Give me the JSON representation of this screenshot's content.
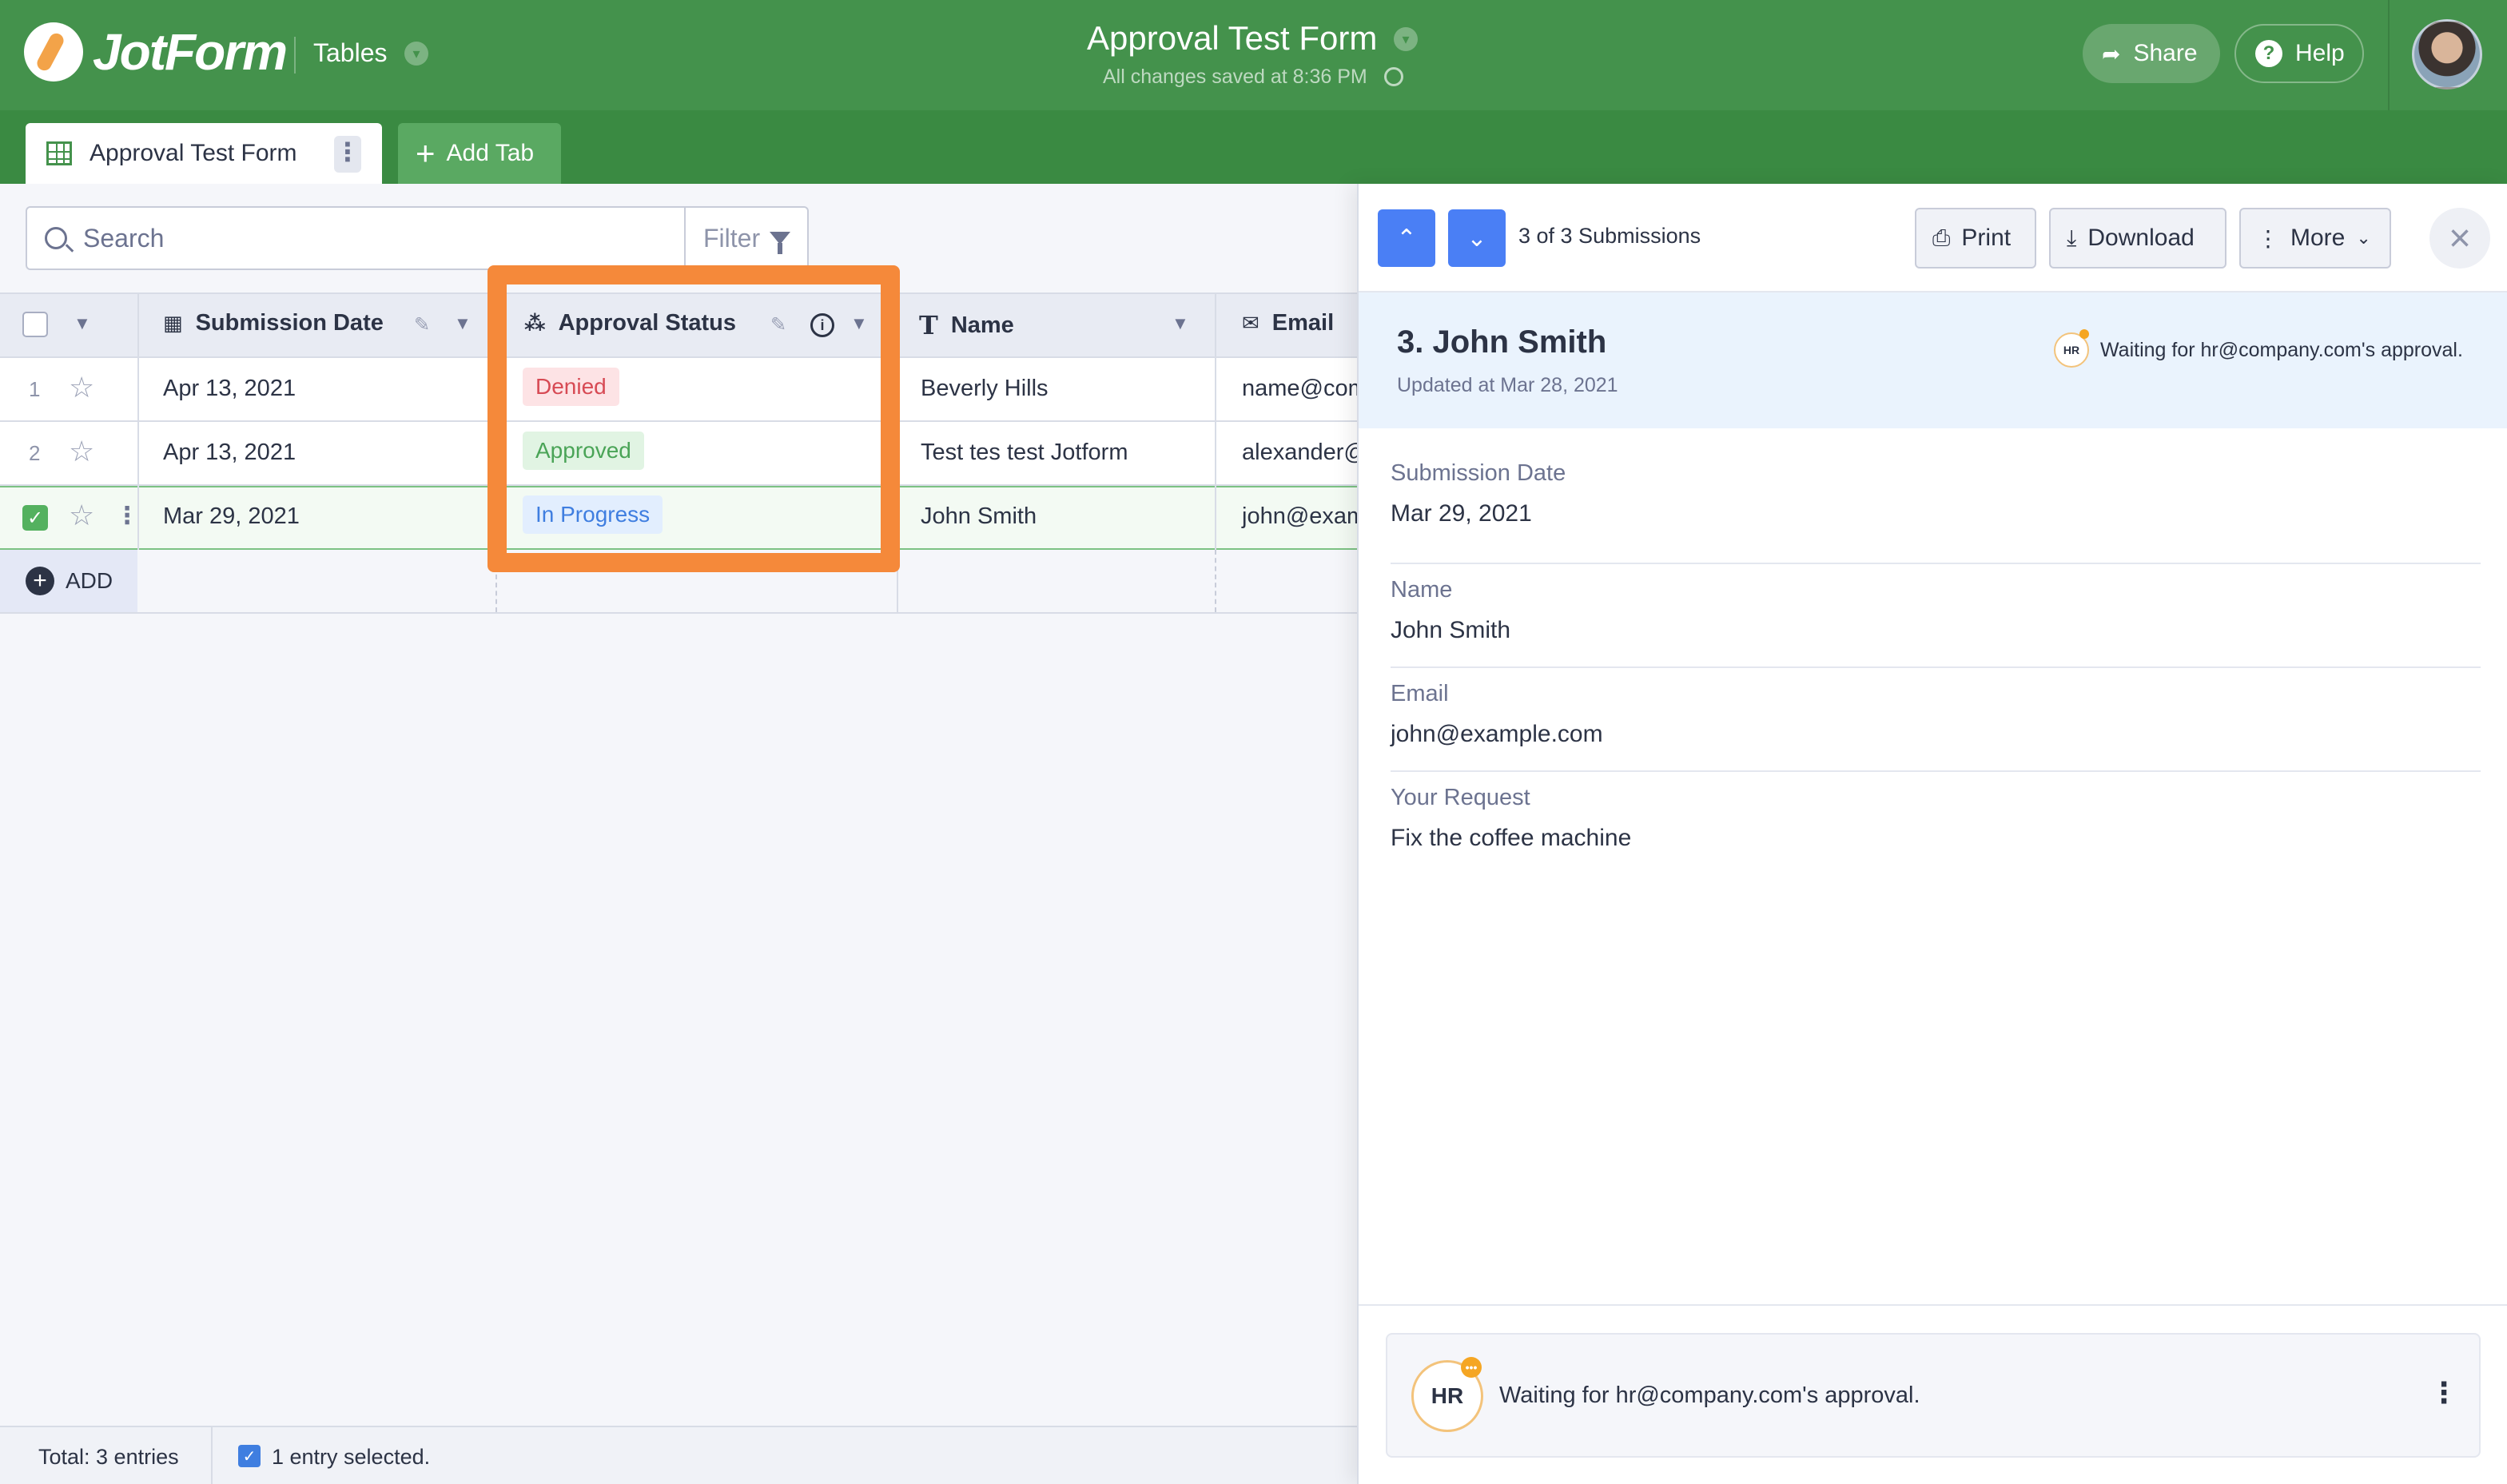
{
  "header": {
    "logo_text": "JotForm",
    "section_label": "Tables",
    "form_title": "Approval Test Form",
    "saved_status": "All changes saved at 8:36 PM",
    "share_label": "Share",
    "help_label": "Help",
    "brand_color": "#44924c"
  },
  "tabs": {
    "active_label": "Approval Test Form",
    "add_tab_label": "Add Tab"
  },
  "toolbar": {
    "search_placeholder": "Search",
    "filter_label": "Filter"
  },
  "table": {
    "columns": [
      {
        "label": "Submission Date",
        "icon": "calendar-icon"
      },
      {
        "label": "Approval Status",
        "icon": "flow-icon"
      },
      {
        "label": "Name",
        "icon": "text-icon"
      },
      {
        "label": "Email",
        "icon": "envelope-icon"
      }
    ],
    "rows": [
      {
        "num": "1",
        "date": "Apr 13, 2021",
        "status": "Denied",
        "name": "Beverly Hills",
        "email": "name@com",
        "selected": false
      },
      {
        "num": "2",
        "date": "Apr 13, 2021",
        "status": "Approved",
        "name": "Test tes test Jotform",
        "email": "alexander@",
        "selected": false
      },
      {
        "num": "3",
        "date": "Mar 29, 2021",
        "status": "In Progress",
        "name": "John Smith",
        "email": "john@exam",
        "selected": true
      }
    ],
    "add_label": "ADD",
    "highlight_color": "#f5893a"
  },
  "footer": {
    "total": "Total: 3 entries",
    "selected": "1 entry selected."
  },
  "panel": {
    "counter": "3 of 3 Submissions",
    "print_label": "Print",
    "download_label": "Download",
    "more_label": "More",
    "title": "3. John Smith",
    "updated": "Updated at Mar 28, 2021",
    "avatar_initials": "HR",
    "waiting_text": "Waiting for hr@company.com's approval.",
    "fields": [
      {
        "label": "Submission Date",
        "value": "Mar 29, 2021"
      },
      {
        "label": "Name",
        "value": "John Smith"
      },
      {
        "label": "Email",
        "value": "john@example.com"
      },
      {
        "label": "Your Request",
        "value": "Fix the coffee machine"
      }
    ],
    "accent_color": "#4a7ff5"
  }
}
